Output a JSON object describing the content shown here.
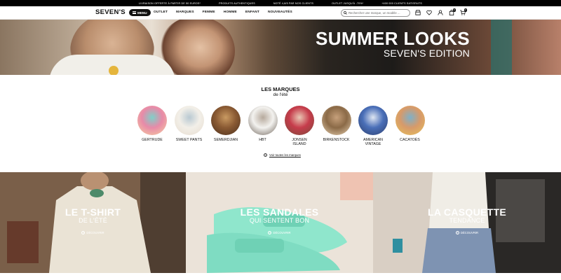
{
  "promo": [
    "Livraison offerte à partir de 50 euros*",
    "Produits authentiques",
    "Noté 4,8/5 par nos clients",
    "Outlet jusqu'à -70%*",
    "+400 000 clients satisfaits"
  ],
  "header": {
    "logo": "SEVEN'S",
    "menu_label": "MENU",
    "nav": [
      "OUTLET",
      "MARQUES",
      "FEMME",
      "HOMME",
      "ENFANT",
      "NOUVEAUTÉS"
    ],
    "search_placeholder": "Rechercher une marque, un modèle ...",
    "wishlist_count": "0",
    "cart_count": "0"
  },
  "hero": {
    "title": "SUMMER LOOKS",
    "subtitle": "SEVEN'S EDITION"
  },
  "brands_section": {
    "title": "LES MARQUES",
    "subtitle": "de l'été",
    "see_all": "Voir toutes les marques",
    "items": [
      {
        "label": "GERTRUDE",
        "colors": [
          "#e88aa8",
          "#7fd0c9",
          "#f5d1a0"
        ]
      },
      {
        "label": "SWEET PANTS",
        "colors": [
          "#f2efe8",
          "#b9c9d2",
          "#e7dccf"
        ]
      },
      {
        "label": "SEMERDJIAN",
        "colors": [
          "#8a5a33",
          "#c99a62",
          "#4b2f1c"
        ]
      },
      {
        "label": "HBT",
        "colors": [
          "#f3f2ef",
          "#b6a99c",
          "#6d6259"
        ]
      },
      {
        "label": "JONSEN ISLAND",
        "colors": [
          "#c63c4b",
          "#e9c7b4",
          "#7a4a3a"
        ]
      },
      {
        "label": "BIRKENSTOCK",
        "colors": [
          "#8b6a47",
          "#c6a07b",
          "#e7d2b3"
        ]
      },
      {
        "label": "AMERICAN\nVINTAGE",
        "colors": [
          "#4a6fb8",
          "#dfe6f2",
          "#2d3f6e"
        ]
      },
      {
        "label": "CACATOÈS",
        "colors": [
          "#d79a6a",
          "#7fb0c8",
          "#e6c15a"
        ]
      }
    ]
  },
  "tiles": [
    {
      "title": "LE T-SHIRT",
      "subtitle": "DE L'ÉTÉ",
      "cta": "DÉCOUVRIR"
    },
    {
      "title": "LES SANDALES",
      "subtitle": "QUI SENTENT BON",
      "cta": "DÉCOUVRIR"
    },
    {
      "title": "LA CASQUETTE",
      "subtitle": "TENDANCE",
      "cta": "DÉCOUVRIR"
    }
  ],
  "colors": {
    "accent": "#111111",
    "sandal": "#7fe0c8"
  }
}
